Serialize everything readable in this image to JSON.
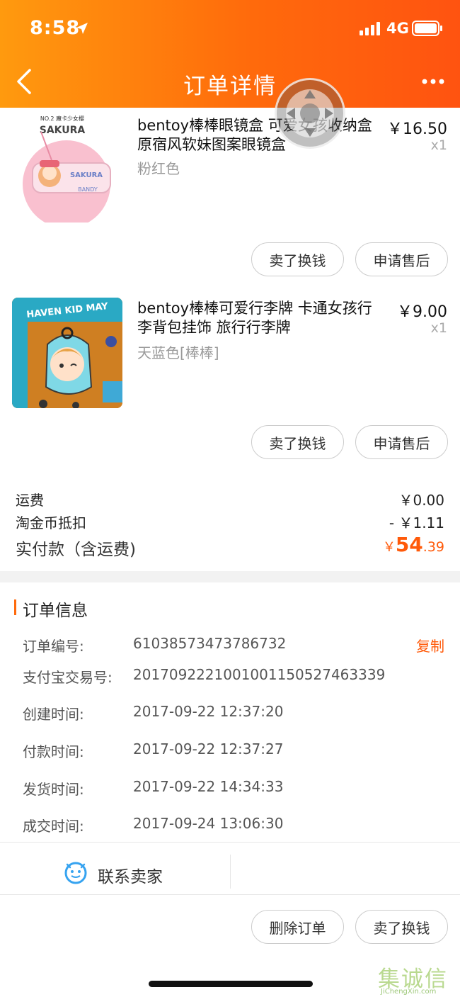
{
  "status_bar": {
    "time": "8:58",
    "network": "4G"
  },
  "nav": {
    "title": "订单详情"
  },
  "items": [
    {
      "name": "bentoy棒棒眼镜盒 可爱女孩收纳盒 原宿风软妹图案眼镜盒",
      "price": "￥16.50",
      "quantity": "x1",
      "variant": "粉红色",
      "thumb_brand": "SAKURA",
      "thumb_top": "NO.2 魔卡少女樱",
      "thumb_label": "BANDY",
      "buttons": [
        "卖了换钱",
        "申请售后"
      ]
    },
    {
      "name": "bentoy棒棒可爱行李牌 卡通女孩行李背包挂饰 旅行行李牌",
      "price": "￥9.00",
      "quantity": "x1",
      "variant": "天蓝色[棒棒]",
      "thumb_text": "HAVEN KID MAY",
      "buttons": [
        "卖了换钱",
        "申请售后"
      ]
    }
  ],
  "fees": {
    "shipping_label": "运费",
    "shipping_value": "￥0.00",
    "coin_label": "淘金币抵扣",
    "coin_value": "- ￥1.11",
    "total_label": "实付款（含运费)",
    "total_currency": "￥",
    "total_int": "54",
    "total_dec": ".39"
  },
  "order_info": {
    "title": "订单信息",
    "copy_label": "复制",
    "rows": [
      {
        "label": "订单编号:",
        "value": "61038573473786732"
      },
      {
        "label": "支付宝交易号:",
        "value": "2017092221001001150527463339"
      },
      {
        "label": "创建时间:",
        "value": "2017-09-22 12:37:20"
      },
      {
        "label": "付款时间:",
        "value": "2017-09-22 12:37:27"
      },
      {
        "label": "发货时间:",
        "value": "2017-09-22 14:34:33"
      },
      {
        "label": "成交时间:",
        "value": "2017-09-24 13:06:30"
      }
    ]
  },
  "contact": {
    "label": "联系卖家"
  },
  "bottom_buttons": {
    "delete": "删除订单",
    "sell": "卖了换钱"
  },
  "watermark": {
    "big": "集诚信",
    "small": "JiChengXin.com"
  },
  "colors": {
    "accent": "#ff5a0a",
    "header_start": "#ff9a0e",
    "header_end": "#ff5310"
  }
}
